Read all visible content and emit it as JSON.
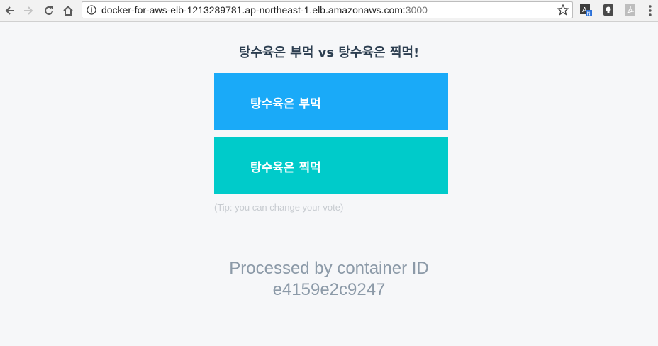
{
  "browser": {
    "url_host": "docker-for-aws-elb-1213289781.ap-northeast-1.elb.amazonaws.com",
    "url_port": ":3000"
  },
  "page": {
    "title": "탕수육은 부먹 vs 탕수육은 찍먹!",
    "option_a": "탕수육은 부먹",
    "option_b": "탕수육은 찍먹",
    "tip": "(Tip: you can change your vote)",
    "processed_line1": "Processed by container ID",
    "container_id": "e4159e2c9247"
  },
  "colors": {
    "option_a": "#1aaaf8",
    "option_b": "#00cbca",
    "title": "#2c3e50",
    "processed": "#8c9aa8"
  },
  "icons": [
    "back-arrow-icon",
    "forward-arrow-icon",
    "reload-icon",
    "home-icon",
    "info-icon",
    "star-icon",
    "dictionary-extension-icon",
    "keep-extension-icon",
    "pdf-extension-icon",
    "menu-dots-icon"
  ]
}
